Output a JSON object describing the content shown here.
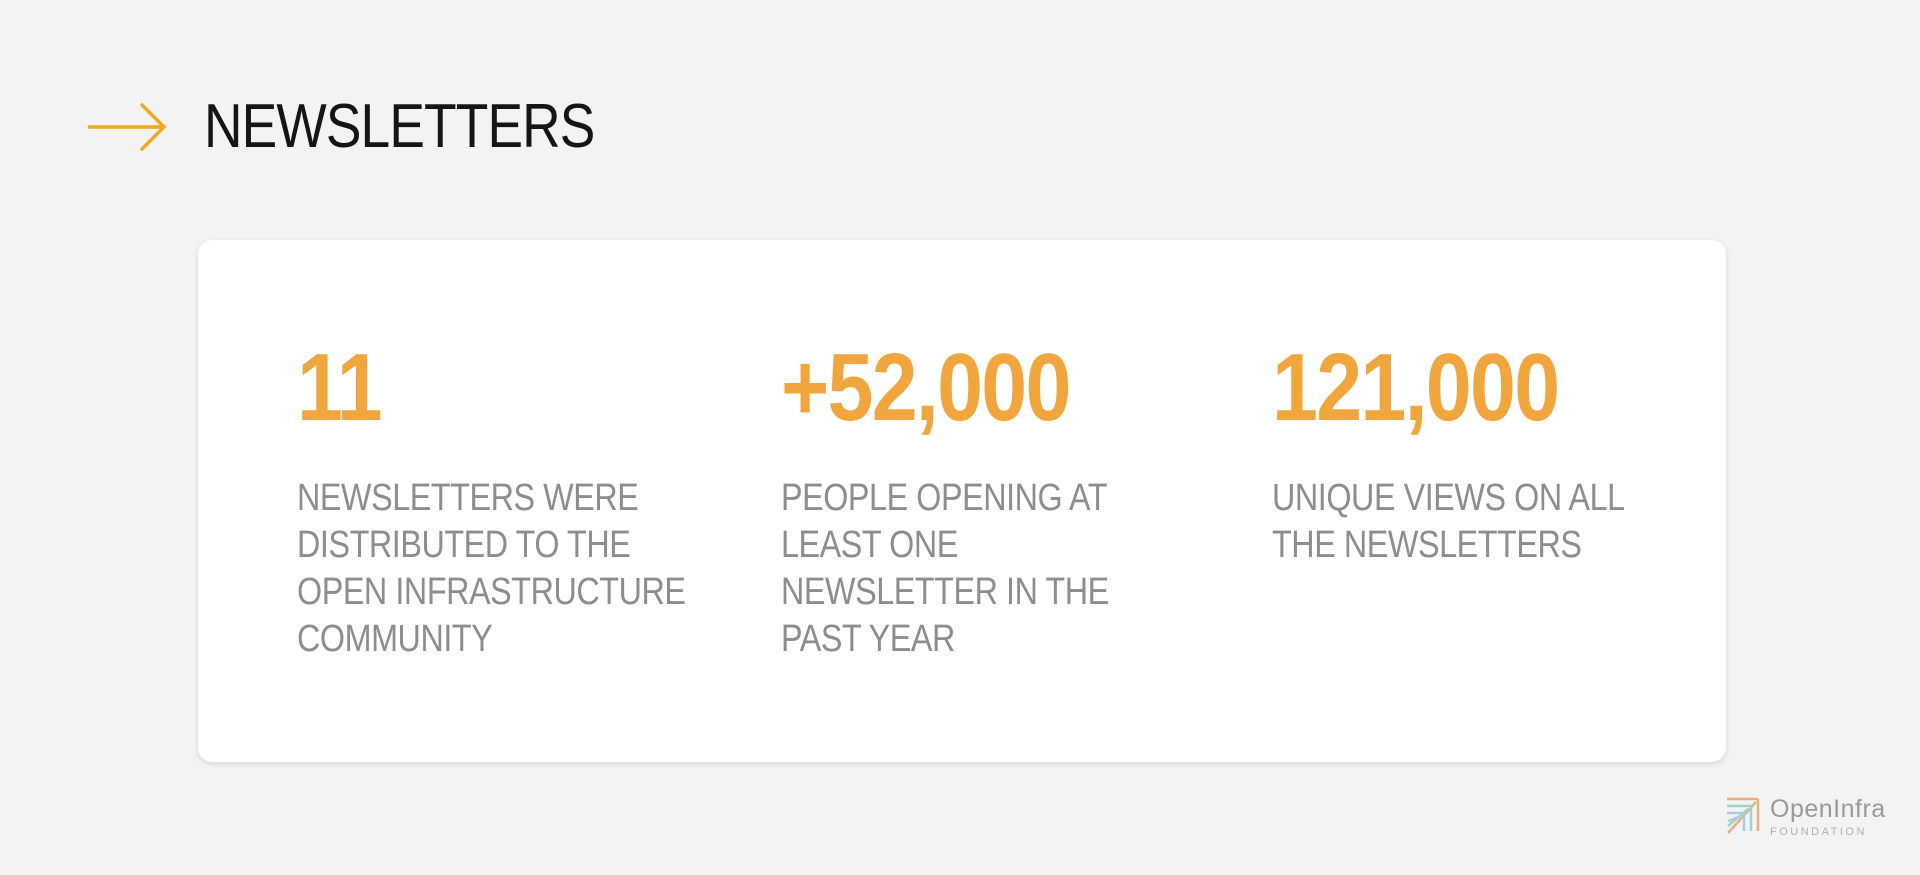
{
  "header": {
    "title": "NEWSLETTERS",
    "icon": "arrow-right-icon"
  },
  "stats": [
    {
      "value": "11",
      "description": "NEWSLETTERS WERE DISTRIBUTED TO THE OPEN INFRASTRUCTURE COMMUNITY"
    },
    {
      "value": "+52,000",
      "description": "PEOPLE OPENING AT LEAST ONE NEWSLETTER IN THE PAST YEAR"
    },
    {
      "value": "121,000",
      "description": "UNIQUE VIEWS ON ALL THE NEWSLETTERS"
    }
  ],
  "logo": {
    "name": "OpenInfra",
    "subtitle": "FOUNDATION"
  },
  "colors": {
    "accent": "#f0a63c",
    "arrow": "#f0a81e",
    "background": "#f3f3f3",
    "card": "#ffffff",
    "title": "#151515",
    "description": "#8d8d8d"
  }
}
